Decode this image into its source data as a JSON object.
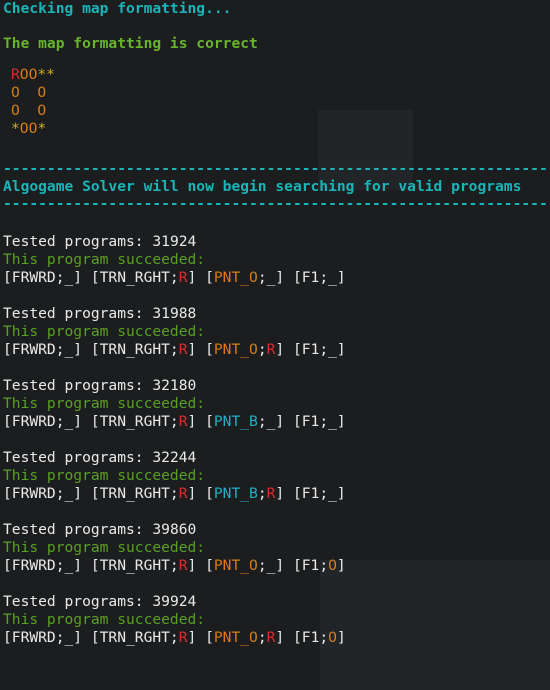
{
  "header": {
    "checking": "Checking map formatting...",
    "correct": "The map formatting is correct"
  },
  "map": {
    "rows": [
      [
        {
          "t": "R",
          "c": "red"
        },
        {
          "t": "OO",
          "c": "orange"
        },
        {
          "t": "**",
          "c": "yellow"
        }
      ],
      [
        {
          "t": "O  O",
          "c": "orange"
        }
      ],
      [
        {
          "t": "O  O",
          "c": "orange"
        }
      ],
      [
        {
          "t": "*",
          "c": "yellow"
        },
        {
          "t": "OO",
          "c": "orange"
        },
        {
          "t": "*",
          "c": "yellow"
        }
      ]
    ]
  },
  "separator": "-----------------------------------------------------------------",
  "banner": "Algogame Solver will now begin searching for valid programs",
  "tested_label": "Tested programs: ",
  "success_text": "This program succeeded:",
  "results": [
    {
      "count": "31924",
      "program": [
        {
          "t": "[FRWRD;_] [TRN_RGHT;",
          "c": "white"
        },
        {
          "t": "R",
          "c": "red"
        },
        {
          "t": "] [",
          "c": "white"
        },
        {
          "t": "PNT_O",
          "c": "orange"
        },
        {
          "t": ";_] [F1;_]",
          "c": "white"
        }
      ]
    },
    {
      "count": "31988",
      "program": [
        {
          "t": "[FRWRD;_] [TRN_RGHT;",
          "c": "white"
        },
        {
          "t": "R",
          "c": "red"
        },
        {
          "t": "] [",
          "c": "white"
        },
        {
          "t": "PNT_O",
          "c": "orange"
        },
        {
          "t": ";",
          "c": "white"
        },
        {
          "t": "R",
          "c": "red"
        },
        {
          "t": "] [F1;_]",
          "c": "white"
        }
      ]
    },
    {
      "count": "32180",
      "program": [
        {
          "t": "[FRWRD;_] [TRN_RGHT;",
          "c": "white"
        },
        {
          "t": "R",
          "c": "red"
        },
        {
          "t": "] [",
          "c": "white"
        },
        {
          "t": "PNT_B",
          "c": "blue"
        },
        {
          "t": ";_] [F1;_]",
          "c": "white"
        }
      ]
    },
    {
      "count": "32244",
      "program": [
        {
          "t": "[FRWRD;_] [TRN_RGHT;",
          "c": "white"
        },
        {
          "t": "R",
          "c": "red"
        },
        {
          "t": "] [",
          "c": "white"
        },
        {
          "t": "PNT_B",
          "c": "blue"
        },
        {
          "t": ";",
          "c": "white"
        },
        {
          "t": "R",
          "c": "red"
        },
        {
          "t": "] [F1;_]",
          "c": "white"
        }
      ]
    },
    {
      "count": "39860",
      "program": [
        {
          "t": "[FRWRD;_] [TRN_RGHT;",
          "c": "white"
        },
        {
          "t": "R",
          "c": "red"
        },
        {
          "t": "] [",
          "c": "white"
        },
        {
          "t": "PNT_O",
          "c": "orange"
        },
        {
          "t": ";_] [F1;",
          "c": "white"
        },
        {
          "t": "O",
          "c": "orange"
        },
        {
          "t": "]",
          "c": "white"
        }
      ]
    },
    {
      "count": "39924",
      "program": [
        {
          "t": "[FRWRD;_] [TRN_RGHT;",
          "c": "white"
        },
        {
          "t": "R",
          "c": "red"
        },
        {
          "t": "] [",
          "c": "white"
        },
        {
          "t": "PNT_O",
          "c": "orange"
        },
        {
          "t": ";",
          "c": "white"
        },
        {
          "t": "R",
          "c": "red"
        },
        {
          "t": "] [F1;",
          "c": "white"
        },
        {
          "t": "O",
          "c": "orange"
        },
        {
          "t": "]",
          "c": "white"
        }
      ]
    }
  ],
  "colors": {
    "background": "#1b1d1f",
    "cyan": "#19b5b8",
    "green": "#68b52c",
    "red": "#d22e2e",
    "orange": "#d57d17",
    "yellow": "#c9b21d",
    "blue": "#1fb1c4"
  }
}
